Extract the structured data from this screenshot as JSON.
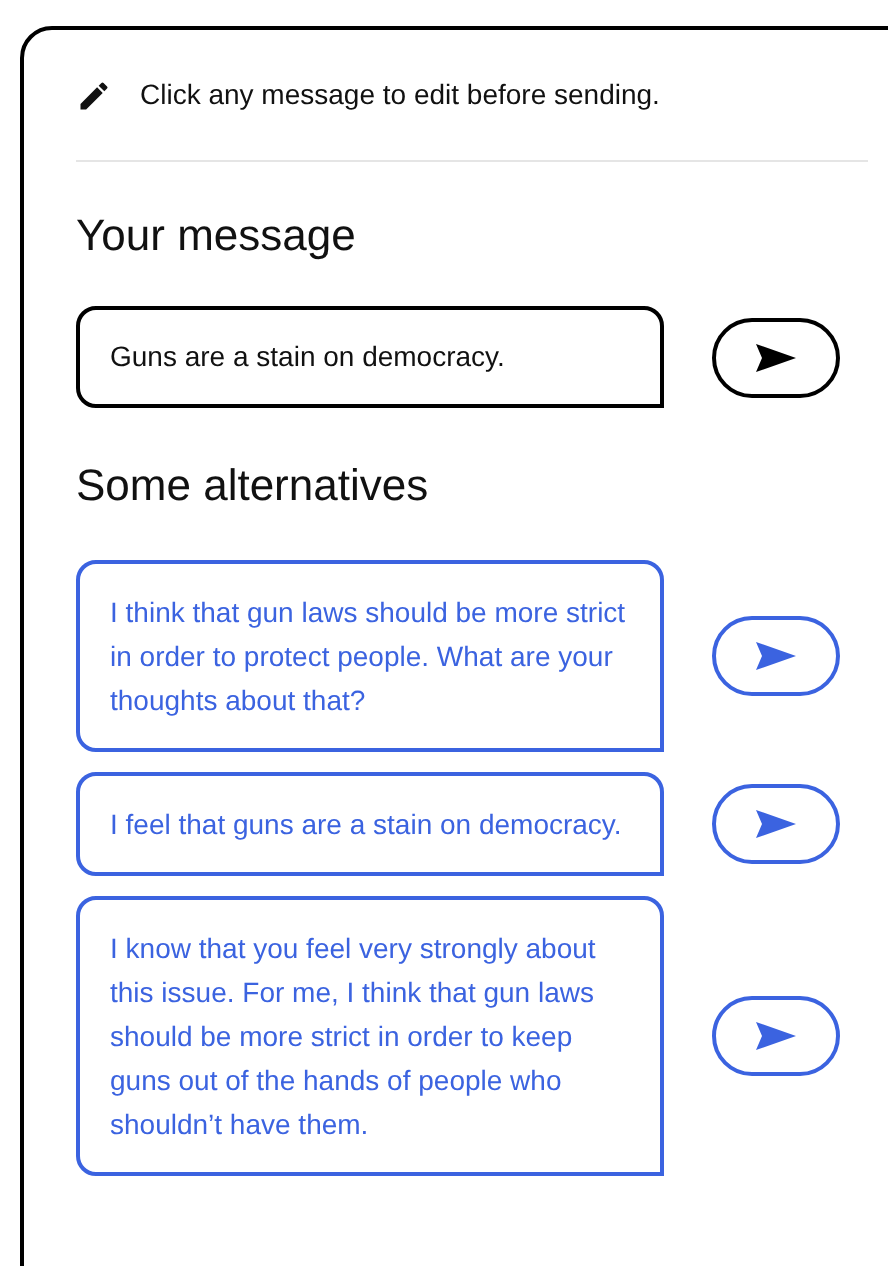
{
  "hint": "Click any message to edit before sending.",
  "your_message": {
    "heading": "Your message",
    "text": "Guns are a stain on democracy."
  },
  "alternatives": {
    "heading": "Some alternatives",
    "items": [
      {
        "text": "I think that gun laws should be more strict in order to protect people. What are your thoughts about that?"
      },
      {
        "text": "I feel that guns are a stain on democracy."
      },
      {
        "text": "I know that you feel very strongly about this issue. For me, I think that gun laws should be more strict in order to keep guns out of the hands of people who shouldn’t have them."
      }
    ]
  }
}
